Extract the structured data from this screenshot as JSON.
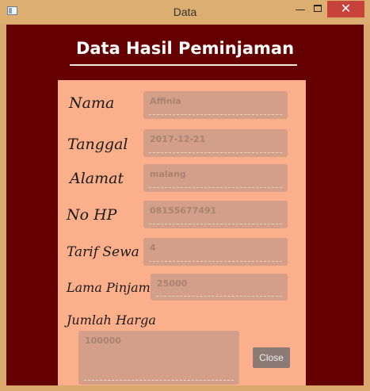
{
  "window": {
    "title": "Data",
    "minimize_glyph": "—",
    "close_glyph": "✕"
  },
  "heading": "Data Hasil Peminjaman",
  "form": {
    "nama": {
      "label": "Nama",
      "value": "Affinia"
    },
    "tanggal": {
      "label": "Tanggal",
      "value": "2017-12-21"
    },
    "alamat": {
      "label": "Alamat",
      "value": "malang"
    },
    "nohp": {
      "label": "No HP",
      "value": "08155677491"
    },
    "tarif": {
      "label": "Tarif Sewa",
      "value": "4"
    },
    "lama": {
      "label": "Lama Pinjam",
      "value": "25000"
    },
    "jumlah": {
      "label": "Jumlah Harga",
      "value": "100000"
    }
  },
  "close_button": "Close",
  "colors": {
    "frame": "#d9a86a",
    "client_bg": "#650000",
    "panel_bg": "#fcaf8b",
    "field_bg": "#d49f89",
    "close_bg": "#8c7b74"
  }
}
